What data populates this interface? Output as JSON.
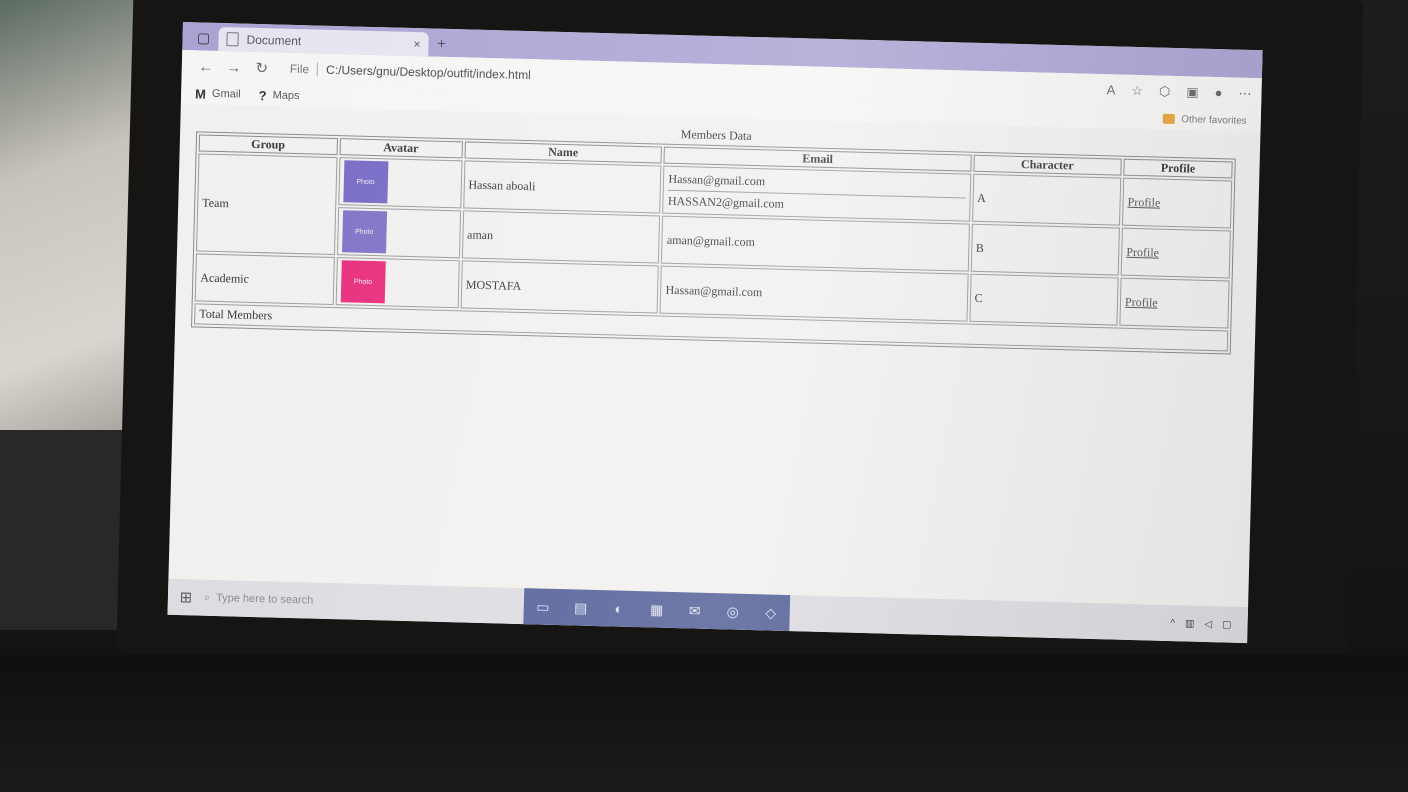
{
  "browser": {
    "tab_title": "Document",
    "tab_close": "×",
    "new_tab": "+",
    "address_prefix": "File",
    "url": "C:/Users/gnu/Desktop/outfit/index.html",
    "bookmarks": [
      {
        "icon": "gmail-icon",
        "glyph": "M",
        "label": "Gmail"
      },
      {
        "icon": "maps-icon",
        "glyph": "?",
        "label": "Maps"
      }
    ],
    "other_favorites": "Other favorites"
  },
  "table": {
    "caption": "Members Data",
    "headers": [
      "Group",
      "Avatar",
      "Name",
      "Email",
      "Character",
      "Profile"
    ],
    "groups": [
      {
        "group": "Team",
        "rows": [
          {
            "avatar_color": "#7468c4",
            "avatar_label": "Photo",
            "name": "Hassan aboali",
            "emails": [
              "Hassan@gmail.com",
              "HASSAN2@gmail.com"
            ],
            "character": "A",
            "profile": "Profile"
          },
          {
            "avatar_color": "#7e70c7",
            "avatar_label": "Photo",
            "name": "aman",
            "emails": [
              "aman@gmail.com"
            ],
            "character": "B",
            "profile": "Profile"
          }
        ]
      },
      {
        "group": "Academic",
        "rows": [
          {
            "avatar_color": "#e8297a",
            "avatar_label": "Photo",
            "name": "MOSTAFA",
            "emails": [
              "Hassan@gmail.com"
            ],
            "character": "C",
            "profile": "Profile"
          }
        ]
      }
    ],
    "footer": "Total Members"
  },
  "taskbar": {
    "search_placeholder": "Type here to search",
    "apps": [
      "task-view-icon",
      "explorer-icon",
      "edge-icon",
      "store-icon",
      "mail-icon",
      "chrome-icon",
      "vscode-icon"
    ]
  }
}
